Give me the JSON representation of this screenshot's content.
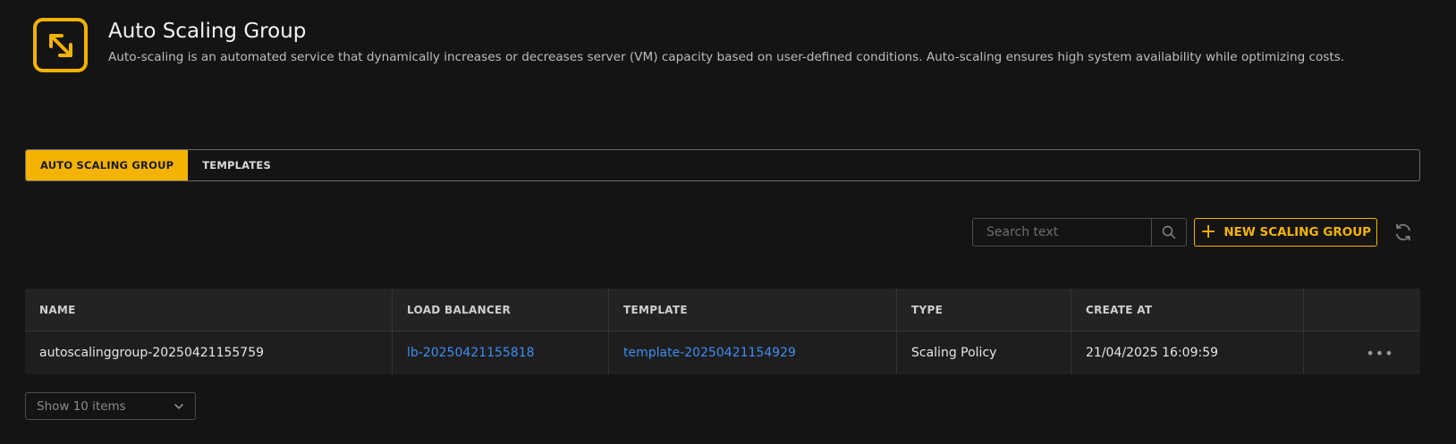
{
  "header": {
    "icon": "resize-arrows-icon",
    "title": "Auto Scaling Group",
    "description": "Auto-scaling is an automated service that dynamically increases or decreases server (VM) capacity based on user-defined conditions. Auto-scaling ensures high system availability while optimizing costs."
  },
  "tabs": [
    {
      "label": "AUTO SCALING GROUP",
      "active": true
    },
    {
      "label": "TEMPLATES",
      "active": false
    }
  ],
  "toolbar": {
    "search_placeholder": "Search text",
    "new_button_label": "NEW SCALING GROUP"
  },
  "table": {
    "columns": [
      "NAME",
      "LOAD BALANCER",
      "TEMPLATE",
      "TYPE",
      "CREATE AT"
    ],
    "rows": [
      {
        "name": "autoscalinggroup-20250421155759",
        "load_balancer": "lb-20250421155818",
        "template": "template-20250421154929",
        "type": "Scaling Policy",
        "created_at": "21/04/2025 16:09:59"
      }
    ]
  },
  "pagination": {
    "page_size_label": "Show 10 items"
  },
  "colors": {
    "accent": "#f5b301",
    "link": "#3d8ef0",
    "background": "#141414"
  }
}
